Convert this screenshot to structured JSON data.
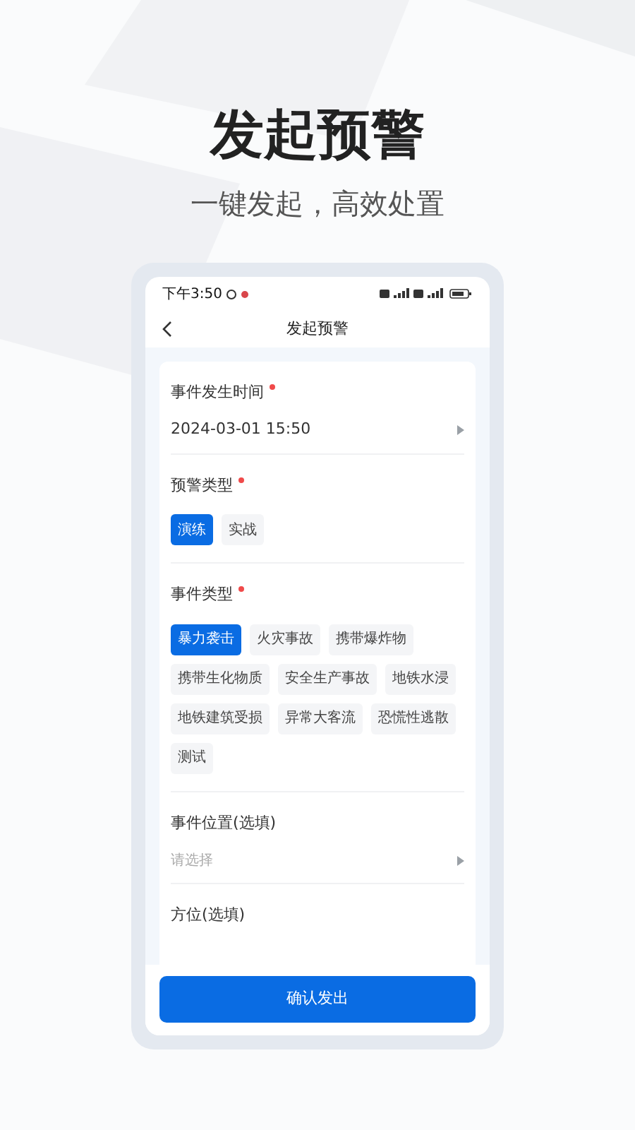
{
  "headline": "发起预警",
  "subheadline": "一键发起，高效处置",
  "status_bar": {
    "time": "下午3:50"
  },
  "nav": {
    "title": "发起预警"
  },
  "form": [
    {
      "kind": "select",
      "label": "事件发生时间",
      "required": true,
      "value": "2024-03-01 15:50"
    },
    {
      "kind": "chips",
      "label": "预警类型",
      "required": true,
      "options": [
        {
          "label": "演练",
          "selected": true
        },
        {
          "label": "实战",
          "selected": false
        }
      ]
    },
    {
      "kind": "chips",
      "label": "事件类型",
      "required": true,
      "options": [
        {
          "label": "暴力袭击",
          "selected": true
        },
        {
          "label": "火灾事故",
          "selected": false
        },
        {
          "label": "携带爆炸物",
          "selected": false
        },
        {
          "label": "携带生化物质",
          "selected": false
        },
        {
          "label": "安全生产事故",
          "selected": false
        },
        {
          "label": "地铁水浸",
          "selected": false
        },
        {
          "label": "地铁建筑受损",
          "selected": false
        },
        {
          "label": "异常大客流",
          "selected": false
        },
        {
          "label": "恐慌性逃散",
          "selected": false
        },
        {
          "label": "测试",
          "selected": false
        }
      ]
    },
    {
      "kind": "select",
      "label": "事件位置(选填)",
      "required": false,
      "placeholder": "请选择"
    },
    {
      "kind": "heading",
      "label": "方位(选填)",
      "required": false
    }
  ],
  "submit": "确认发出"
}
